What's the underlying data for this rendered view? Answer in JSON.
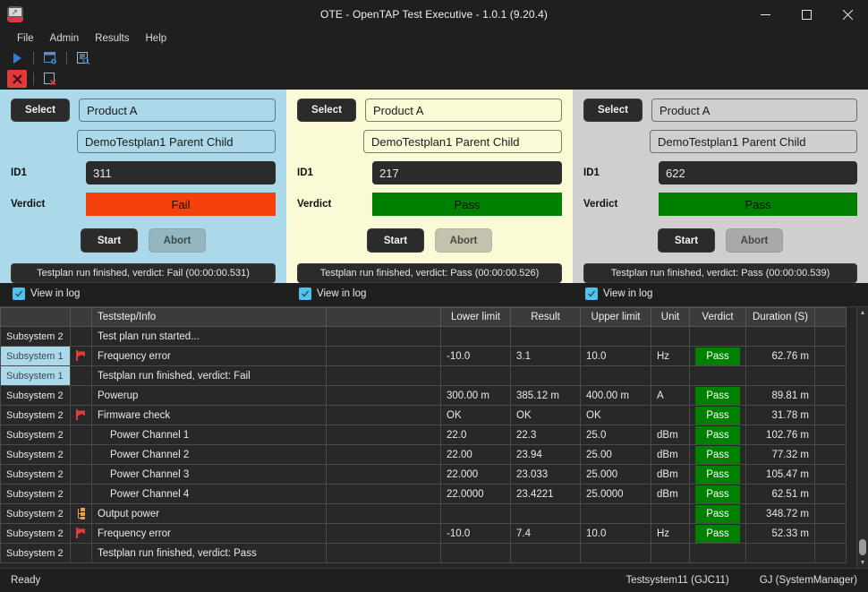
{
  "window": {
    "title": "OTE - OpenTAP Test Executive - 1.0.1  (9.20.4)",
    "app_icon": "opentap-icon",
    "minimize": "minimize-icon",
    "maximize": "maximize-icon",
    "close": "close-icon"
  },
  "menu": {
    "items": [
      "File",
      "Admin",
      "Results",
      "Help"
    ]
  },
  "toolbar_top": [
    {
      "name": "run-icon",
      "glyph": "play"
    },
    {
      "name": "separator",
      "glyph": "sep"
    },
    {
      "name": "test-settings-icon",
      "glyph": "window-gear"
    },
    {
      "name": "separator",
      "glyph": "sep"
    },
    {
      "name": "view-results-icon",
      "glyph": "doc-search"
    }
  ],
  "toolbar_second": [
    {
      "name": "abort-all-icon",
      "glyph": "red-x",
      "selected": true
    },
    {
      "name": "separator",
      "glyph": "sep"
    },
    {
      "name": "clear-log-icon",
      "glyph": "doc-x"
    }
  ],
  "panels": [
    {
      "id": "panel-1",
      "theme": "blue",
      "select_label": "Select",
      "product": "Product A",
      "testplan": "DemoTestplan1 Parent Child",
      "id_label": "ID1",
      "id_value": "311",
      "verdict_label": "Verdict",
      "verdict": "Fail",
      "verdict_color": "#F5410B",
      "start_label": "Start",
      "abort_label": "Abort",
      "status": "Testplan run finished, verdict: Fail (00:00:00.531)",
      "view_in_log": "View in log",
      "view_in_log_checked": true
    },
    {
      "id": "panel-2",
      "theme": "cream",
      "select_label": "Select",
      "product": "Product A",
      "testplan": "DemoTestplan1 Parent Child",
      "id_label": "ID1",
      "id_value": "217",
      "verdict_label": "Verdict",
      "verdict": "Pass",
      "verdict_color": "#008000",
      "start_label": "Start",
      "abort_label": "Abort",
      "status": "Testplan run finished, verdict: Pass (00:00:00.526)",
      "view_in_log": "View in log",
      "view_in_log_checked": true
    },
    {
      "id": "panel-3",
      "theme": "gray",
      "select_label": "Select",
      "product": "Product A",
      "testplan": "DemoTestplan1 Parent Child",
      "id_label": "ID1",
      "id_value": "622",
      "verdict_label": "Verdict",
      "verdict": "Pass",
      "verdict_color": "#008000",
      "start_label": "Start",
      "abort_label": "Abort",
      "status": "Testplan run finished, verdict: Pass (00:00:00.539)",
      "view_in_log": "View in log",
      "view_in_log_checked": true
    }
  ],
  "table": {
    "columns": [
      "",
      "",
      "Teststep/Info",
      "",
      "Lower limit",
      "Result",
      "Upper limit",
      "Unit",
      "Verdict",
      "Duration (S)",
      ""
    ],
    "rows": [
      {
        "subsystem": "Subsystem 2",
        "sub_theme": "sub2",
        "icon": "",
        "name": "Test plan run started...",
        "indent": 0,
        "lower": "",
        "result": "",
        "upper": "",
        "unit": "",
        "verdict": "",
        "duration": ""
      },
      {
        "subsystem": "Subsystem 1",
        "sub_theme": "sub1",
        "icon": "flag",
        "name": "Frequency error",
        "indent": 0,
        "lower": "-10.0",
        "result": "3.1",
        "upper": "10.0",
        "unit": "Hz",
        "verdict": "Pass",
        "duration": "62.76 m"
      },
      {
        "subsystem": "Subsystem 1",
        "sub_theme": "sub1",
        "icon": "",
        "name": "Testplan run finished, verdict: Fail",
        "indent": 0,
        "lower": "",
        "result": "",
        "upper": "",
        "unit": "",
        "verdict": "",
        "duration": ""
      },
      {
        "subsystem": "Subsystem 2",
        "sub_theme": "sub2",
        "icon": "",
        "name": "Powerup",
        "indent": 0,
        "lower": "300.00 m",
        "result": "385.12 m",
        "upper": "400.00 m",
        "unit": "A",
        "verdict": "Pass",
        "duration": "89.81 m"
      },
      {
        "subsystem": "Subsystem 2",
        "sub_theme": "sub2",
        "icon": "flag",
        "name": "Firmware check",
        "indent": 0,
        "lower": "OK",
        "result": "OK",
        "upper": "OK",
        "unit": "",
        "verdict": "Pass",
        "duration": "31.78 m"
      },
      {
        "subsystem": "Subsystem 2",
        "sub_theme": "sub2",
        "icon": "",
        "name": "Power Channel 1",
        "indent": 1,
        "lower": "22.0",
        "result": "22.3",
        "upper": "25.0",
        "unit": "dBm",
        "verdict": "Pass",
        "duration": "102.76 m"
      },
      {
        "subsystem": "Subsystem 2",
        "sub_theme": "sub2",
        "icon": "",
        "name": "Power Channel 2",
        "indent": 1,
        "lower": "22.00",
        "result": "23.94",
        "upper": "25.00",
        "unit": "dBm",
        "verdict": "Pass",
        "duration": "77.32 m"
      },
      {
        "subsystem": "Subsystem 2",
        "sub_theme": "sub2",
        "icon": "",
        "name": "Power Channel 3",
        "indent": 1,
        "lower": "22.000",
        "result": "23.033",
        "upper": "25.000",
        "unit": "dBm",
        "verdict": "Pass",
        "duration": "105.47 m"
      },
      {
        "subsystem": "Subsystem 2",
        "sub_theme": "sub2",
        "icon": "",
        "name": "Power Channel 4",
        "indent": 1,
        "lower": "22.0000",
        "result": "23.4221",
        "upper": "25.0000",
        "unit": "dBm",
        "verdict": "Pass",
        "duration": "62.51 m"
      },
      {
        "subsystem": "Subsystem 2",
        "sub_theme": "sub2",
        "icon": "tree",
        "name": "Output power",
        "indent": 0,
        "lower": "",
        "result": "",
        "upper": "",
        "unit": "",
        "verdict": "Pass",
        "duration": "348.72 m"
      },
      {
        "subsystem": "Subsystem 2",
        "sub_theme": "sub2",
        "icon": "flag",
        "name": "Frequency error",
        "indent": 0,
        "lower": "-10.0",
        "result": "7.4",
        "upper": "10.0",
        "unit": "Hz",
        "verdict": "Pass",
        "duration": "52.33 m"
      },
      {
        "subsystem": "Subsystem 2",
        "sub_theme": "sub2",
        "icon": "",
        "name": "Testplan run finished, verdict: Pass",
        "indent": 0,
        "lower": "",
        "result": "",
        "upper": "",
        "unit": "",
        "verdict": "",
        "duration": ""
      }
    ]
  },
  "statusbar": {
    "ready": "Ready",
    "system": "Testsystem11 (GJC11)",
    "user": "GJ (SystemManager)"
  }
}
